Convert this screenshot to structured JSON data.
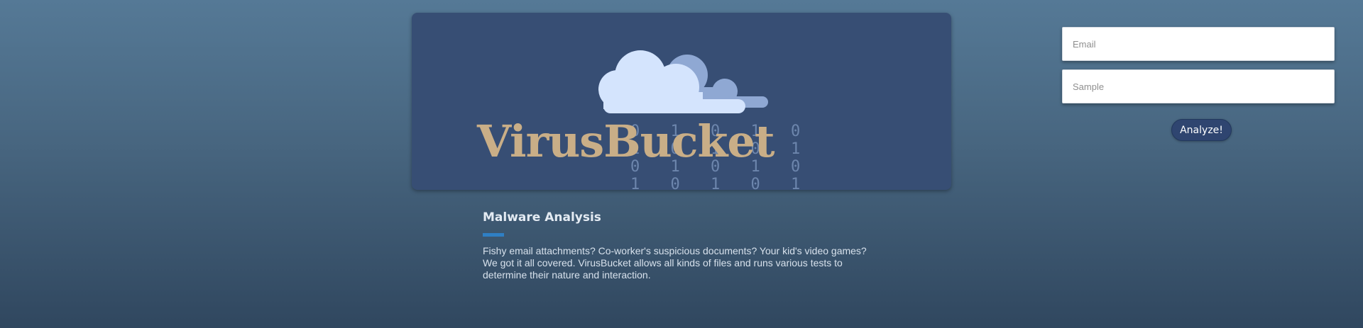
{
  "hero": {
    "brand": "VirusBucket",
    "binary_lines": [
      "0 1 0 1 0",
      "1 0 1 0 1",
      "0 1 0 1 0",
      "1 0 1 0 1"
    ]
  },
  "section": {
    "title": "Malware Analysis",
    "body": "Fishy email attachments? Co-worker's suspicious documents? Your kid's video games? We got it all covered. VirusBucket allows all kinds of files and runs various tests to determine their nature and interaction."
  },
  "form": {
    "email_placeholder": "Email",
    "sample_placeholder": "Sample",
    "submit_label": "Analyze!"
  },
  "colors": {
    "background_top": "#557996",
    "background_bottom": "#30475f",
    "card": "#374e74",
    "brand_text": "#c9ae87",
    "cloud_front": "#d4e4fd",
    "cloud_back": "#8fa8d3",
    "accent_bar": "#2f7fc4",
    "button": "#2f4570"
  },
  "icons": [
    "cloud-icon"
  ]
}
